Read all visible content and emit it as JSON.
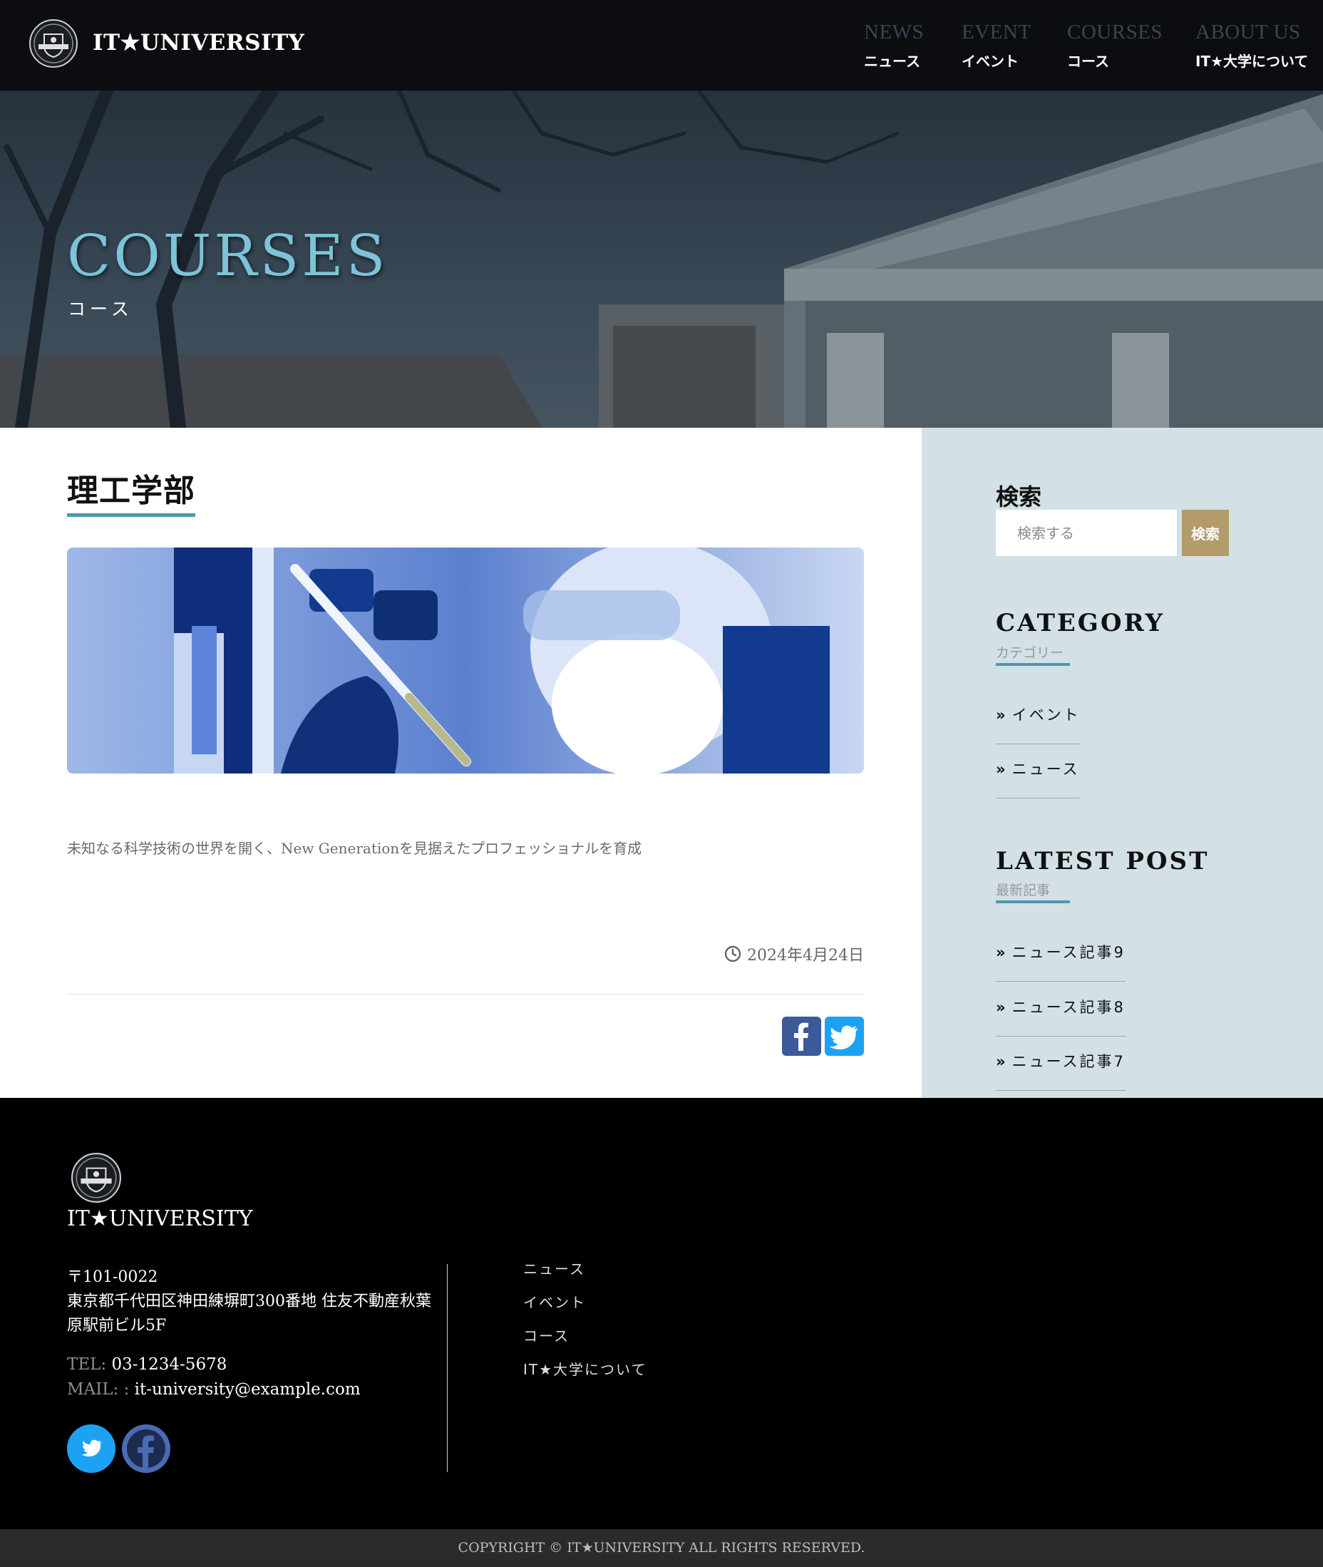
{
  "header": {
    "brand": "IT★UNIVERSITY",
    "nav": [
      {
        "en": "NEWS",
        "ja": "ニュース"
      },
      {
        "en": "EVENT",
        "ja": "イベント"
      },
      {
        "en": "COURSES",
        "ja": "コース"
      },
      {
        "en": "ABOUT US",
        "ja": "IT★大学について"
      }
    ]
  },
  "hero": {
    "title": "COURSES",
    "subtitle": "コース"
  },
  "post": {
    "title": "理工学部",
    "text": "未知なる科学技術の世界を開く、New Generationを見据えたプロフェッショナルを育成",
    "date": "2024年4月24日"
  },
  "sidebar": {
    "search": {
      "heading": "検索",
      "placeholder": "検索する",
      "button": "検索"
    },
    "category": {
      "heading": "CATEGORY",
      "sub": "カテゴリー",
      "items": [
        "イベント",
        "ニュース"
      ]
    },
    "latest": {
      "heading": "LATEST POST",
      "sub": "最新記事",
      "items": [
        "ニュース記事9",
        "ニュース記事8",
        "ニュース記事7"
      ]
    }
  },
  "footer": {
    "brand": "IT★UNIVERSITY",
    "address_line1": "〒101-0022",
    "address_line2": "東京都千代田区神田練塀町300番地 住友不動産秋葉原駅前ビル5F",
    "tel_label": "TEL:",
    "tel": "03-1234-5678",
    "mail_label": "MAIL: :",
    "mail": "it-university@example.com",
    "links": [
      "ニュース",
      "イベント",
      "コース",
      "IT★大学について"
    ],
    "copyright": "COPYRIGHT © IT★UNIVERSITY ALL RIGHTS RESERVED."
  },
  "colors": {
    "accent": "#4d98ad",
    "hero_title": "#7cc3d8",
    "search_button": "#b39b6a",
    "sidebar_bg": "#d3e1e6",
    "footer_bg": "#000000"
  },
  "icons": [
    "university-seal-icon",
    "clock-icon",
    "facebook-icon",
    "twitter-icon",
    "double-chevron-right-icon"
  ]
}
